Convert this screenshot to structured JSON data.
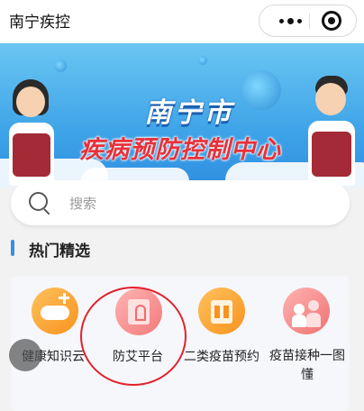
{
  "header": {
    "title": "南宁疾控"
  },
  "banner": {
    "title_line1": "南宁市",
    "title_line2": "疾病预防控制中心"
  },
  "search": {
    "placeholder": "搜索"
  },
  "section": {
    "title": "热门精选"
  },
  "items": [
    {
      "label": "健康知识云",
      "icon": "cloud-plus-icon",
      "color": "#f7a033"
    },
    {
      "label": "防艾平台",
      "icon": "aids-ribbon-icon",
      "color": "#f27a7a"
    },
    {
      "label": "二类疫苗预约",
      "icon": "vaccine-box-icon",
      "color": "#f7a033"
    },
    {
      "label": "疫苗接种一图懂",
      "icon": "injection-icon",
      "color": "#f08080"
    }
  ],
  "colors": {
    "accent": "#3a8ee6",
    "highlight_ring": "#e4202b"
  }
}
